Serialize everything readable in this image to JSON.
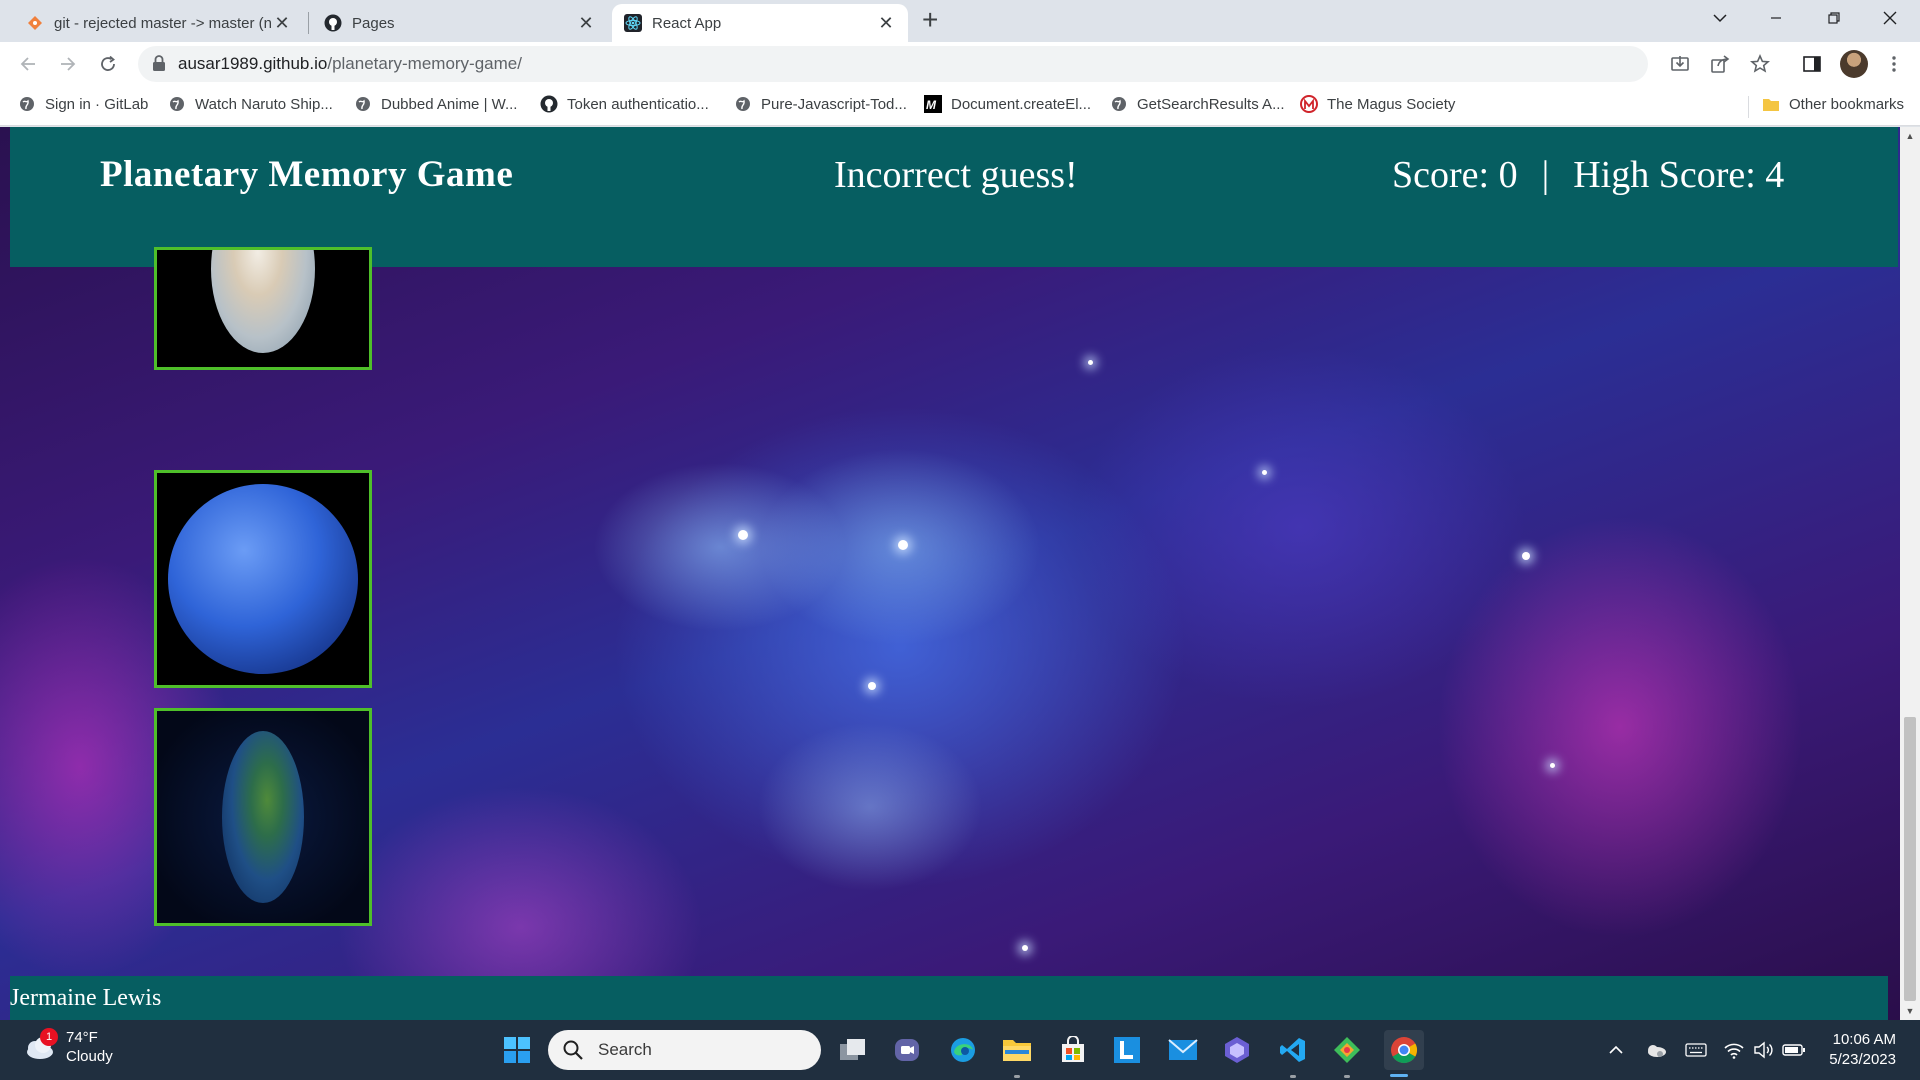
{
  "browser": {
    "tabs": [
      {
        "title": "git - rejected master -> master (n",
        "icon": "git-icon"
      },
      {
        "title": "Pages",
        "icon": "github-icon"
      },
      {
        "title": "React App",
        "icon": "react-icon",
        "active": true
      }
    ],
    "url": {
      "host": "ausar1989.github.io",
      "path": "/planetary-memory-game/"
    },
    "bookmarks": [
      {
        "label": "Sign in · GitLab",
        "icon": "globe-icon"
      },
      {
        "label": "Watch Naruto Ship...",
        "icon": "globe-icon"
      },
      {
        "label": "Dubbed Anime | W...",
        "icon": "globe-icon"
      },
      {
        "label": "Token authenticatio...",
        "icon": "github-icon"
      },
      {
        "label": "Pure-Javascript-Tod...",
        "icon": "globe-icon"
      },
      {
        "label": "Document.createEl...",
        "icon": "mdn-icon"
      },
      {
        "label": "GetSearchResults A...",
        "icon": "globe-icon"
      },
      {
        "label": "The Magus Society",
        "icon": "magus-icon"
      }
    ],
    "other_bookmarks": "Other bookmarks"
  },
  "game": {
    "title": "Planetary Memory Game",
    "status": "Incorrect guess!",
    "score_label": "Score: 0",
    "separator": "|",
    "high_score_label": "High Score: 4",
    "cards": [
      {
        "planet": "venus"
      },
      {
        "planet": "neptune"
      },
      {
        "planet": "earth"
      }
    ],
    "footer": "Jermaine Lewis",
    "colors": {
      "header": "#065e61",
      "card_border": "#4fbf2a"
    }
  },
  "taskbar": {
    "weather": {
      "temp": "74°F",
      "condition": "Cloudy",
      "badge": "1"
    },
    "search_placeholder": "Search",
    "clock": {
      "time": "10:06 AM",
      "date": "5/23/2023"
    }
  }
}
